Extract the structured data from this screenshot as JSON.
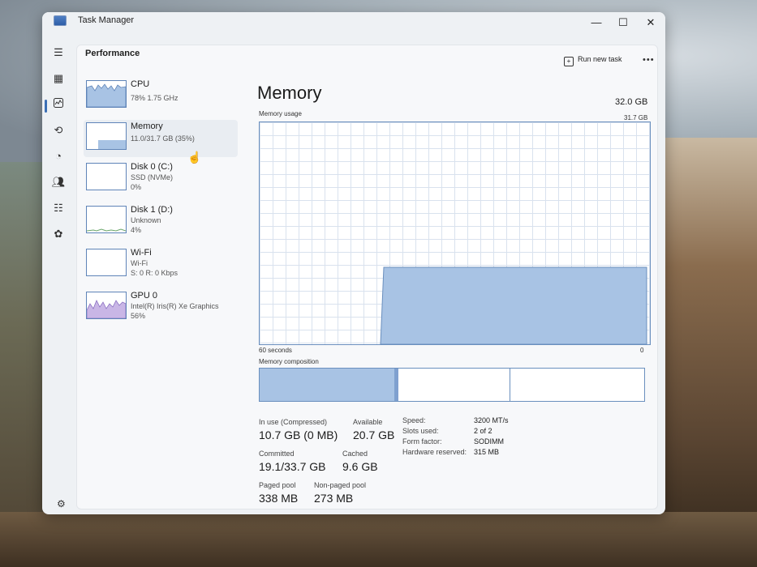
{
  "window": {
    "title": "Task Manager",
    "controls": {
      "minimize": "—",
      "maximize": "☐",
      "close": "✕"
    }
  },
  "nav": {
    "icons": [
      "hamburger-icon",
      "processes-icon",
      "performance-icon",
      "app-history-icon",
      "startup-apps-icon",
      "users-icon",
      "details-icon",
      "services-icon",
      "settings-icon"
    ],
    "active": "performance"
  },
  "header": {
    "section_title": "Performance",
    "run_new_task": "Run new task",
    "more": "•••"
  },
  "devices": [
    {
      "name": "CPU",
      "line1": "78% 1.75 GHz",
      "line2": ""
    },
    {
      "name": "Memory",
      "line1": "11.0/31.7 GB (35%)",
      "line2": ""
    },
    {
      "name": "Disk 0 (C:)",
      "line1": "SSD (NVMe)",
      "line2": "0%"
    },
    {
      "name": "Disk 1 (D:)",
      "line1": "Unknown",
      "line2": "4%"
    },
    {
      "name": "Wi-Fi",
      "line1": "Wi-Fi",
      "line2": "S: 0 R: 0 Kbps"
    },
    {
      "name": "GPU 0",
      "line1": "Intel(R) Iris(R) Xe Graphics",
      "line2": "56%"
    }
  ],
  "memory": {
    "title": "Memory",
    "total": "32.0 GB",
    "usage_label": "Memory usage",
    "usage_max": "31.7 GB",
    "axis_left": "60 seconds",
    "axis_right": "0",
    "composition_label": "Memory composition",
    "composition": {
      "in_use_fraction": 0.35,
      "modified_fraction": 0.01,
      "standby_fraction": 0.29
    },
    "usage_history": {
      "start_fraction": 0.31,
      "level_fraction": 0.345
    }
  },
  "stats": {
    "in_use_label": "In use (Compressed)",
    "in_use_value": "10.7 GB (0 MB)",
    "available_label": "Available",
    "available_value": "20.7 GB",
    "committed_label": "Committed",
    "committed_value": "19.1/33.7 GB",
    "cached_label": "Cached",
    "cached_value": "9.6 GB",
    "paged_pool_label": "Paged pool",
    "paged_pool_value": "338 MB",
    "non_paged_pool_label": "Non-paged pool",
    "non_paged_pool_value": "273 MB"
  },
  "specs": {
    "speed_label": "Speed:",
    "speed_value": "3200 MT/s",
    "slots_label": "Slots used:",
    "slots_value": "2 of 2",
    "form_factor_label": "Form factor:",
    "form_factor_value": "SODIMM",
    "hw_reserved_label": "Hardware reserved:",
    "hw_reserved_value": "315 MB"
  },
  "colors": {
    "accent": "#3b6fb5",
    "graph_fill": "#a8c3e4",
    "graph_border": "#6a8fbe"
  }
}
